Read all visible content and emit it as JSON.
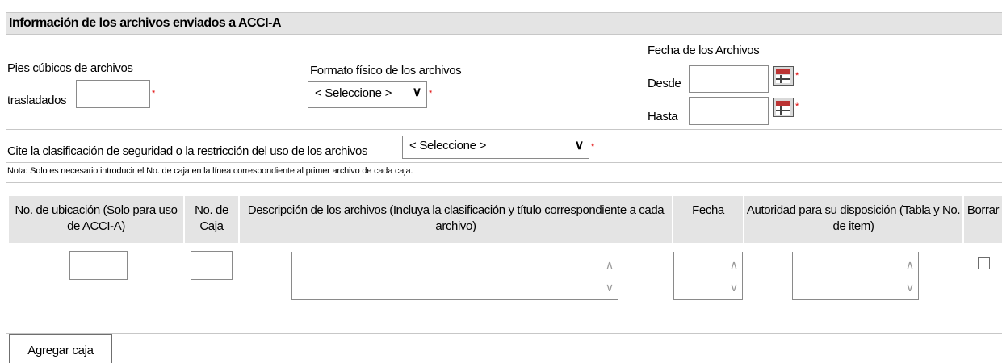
{
  "section_title": "Información de los archivos enviados a ACCI-A",
  "cubic_feet": {
    "label_line1": "Pies cúbicos de archivos",
    "label_line2": "trasladados",
    "value": "",
    "required_mark": "*"
  },
  "physical_format": {
    "label": "Formato físico de los archivos",
    "selected": "< Seleccione >",
    "required_mark": "*"
  },
  "dates": {
    "label": "Fecha de los Archivos",
    "from_label": "Desde",
    "to_label": "Hasta",
    "from_value": "",
    "to_value": "",
    "required_mark": "*"
  },
  "security": {
    "label": "Cite la clasificación de seguridad o la restricción del uso de los archivos",
    "selected": "< Seleccione >",
    "required_mark": "*"
  },
  "note": "Nota: Solo es necesario introducir el No. de caja en la línea correspondiente al primer archivo de cada caja.",
  "table": {
    "headers": [
      "No. de ubicación (Solo para uso de ACCI-A)",
      "No. de Caja",
      "Descripción de los archivos (Incluya la clasificación y título correspondiente a cada archivo)",
      "Fecha",
      "Autoridad para su disposición (Tabla y No. de item)",
      "Borrar"
    ],
    "row": {
      "location": "",
      "box": "",
      "description": "",
      "date": "",
      "authority": "",
      "delete_checked": false
    }
  },
  "add_box_label": "Agregar caja",
  "colors": {
    "header_bg": "#e4e4e4",
    "border": "#c7c7c7",
    "required": "#e00000"
  },
  "icons": {
    "calendar": "calendar-icon",
    "dropdown": "chevron-down-icon",
    "scroll_up": "scroll-up-icon",
    "scroll_down": "scroll-down-icon"
  }
}
